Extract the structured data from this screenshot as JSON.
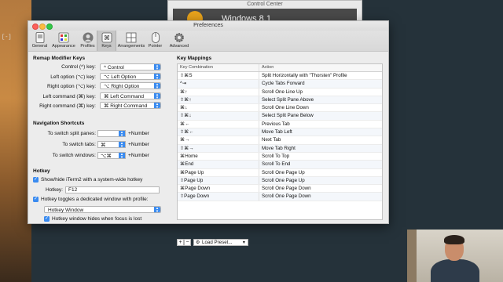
{
  "background": {
    "terminal_prompt": "[-]",
    "control_center": {
      "title": "Control Center",
      "item": "Windows 8.1"
    }
  },
  "window": {
    "title": "Preferences"
  },
  "toolbar": {
    "tabs": [
      {
        "label": "General",
        "icon": "general-icon"
      },
      {
        "label": "Appearance",
        "icon": "appearance-icon"
      },
      {
        "label": "Profiles",
        "icon": "profiles-icon"
      },
      {
        "label": "Keys",
        "icon": "keys-icon",
        "selected": true
      },
      {
        "label": "Arrangements",
        "icon": "arrangements-icon"
      },
      {
        "label": "Pointer",
        "icon": "pointer-icon"
      },
      {
        "label": "Advanced",
        "icon": "advanced-icon"
      }
    ]
  },
  "remap": {
    "title": "Remap Modifier Keys",
    "rows": [
      {
        "label": "Control (^) key:",
        "value": "^ Control"
      },
      {
        "label": "Left option (⌥) key:",
        "value": "⌥ Left Option"
      },
      {
        "label": "Right option (⌥) key:",
        "value": "⌥ Right Option"
      },
      {
        "label": "Left command (⌘) key:",
        "value": "⌘ Left Command"
      },
      {
        "label": "Right command (⌘) key:",
        "value": "⌘ Right Command"
      }
    ]
  },
  "navigation": {
    "title": "Navigation Shortcuts",
    "rows": [
      {
        "label": "To switch split panes:",
        "value": "",
        "suffix": "+Number"
      },
      {
        "label": "To switch tabs:",
        "value": "⌘",
        "suffix": "+Number"
      },
      {
        "label": "To switch windows:",
        "value": "⌥⌘",
        "suffix": "+Number"
      }
    ]
  },
  "hotkey": {
    "title": "Hotkey",
    "show_hide_label": "Show/hide iTerm2 with a system-wide hotkey",
    "hotkey_label": "Hotkey:",
    "hotkey_value": "F12",
    "toggles_label": "Hotkey toggles a dedicated window with profile:",
    "profile_value": "Hotkey Window",
    "hides_label": "Hotkey window hides when focus is lost"
  },
  "key_mappings": {
    "title": "Key Mappings",
    "col_combo": "Key Combination",
    "col_action": "Action",
    "rows": [
      {
        "combo": "⇧⌘S",
        "action": "Split Horizontally with \"Thorsten\" Profile"
      },
      {
        "combo": "^⇥",
        "action": "Cycle Tabs Forward"
      },
      {
        "combo": "⌘↑",
        "action": "Scroll One Line Up"
      },
      {
        "combo": "⇧⌘↑",
        "action": "Select Split Pane Above"
      },
      {
        "combo": "⌘↓",
        "action": "Scroll One Line Down"
      },
      {
        "combo": "⇧⌘↓",
        "action": "Select Split Pane Below"
      },
      {
        "combo": "⌘←",
        "action": "Previous Tab"
      },
      {
        "combo": "⇧⌘←",
        "action": "Move Tab Left"
      },
      {
        "combo": "⌘→",
        "action": "Next Tab"
      },
      {
        "combo": "⇧⌘→",
        "action": "Move Tab Right"
      },
      {
        "combo": "⌘Home",
        "action": "Scroll To Top"
      },
      {
        "combo": "⌘End",
        "action": "Scroll To End"
      },
      {
        "combo": "⌘Page Up",
        "action": "Scroll One Page Up"
      },
      {
        "combo": "⇧Page Up",
        "action": "Scroll One Page Up"
      },
      {
        "combo": "⌘Page Down",
        "action": "Scroll One Page Down"
      },
      {
        "combo": "⇧Page Down",
        "action": "Scroll One Page Down"
      }
    ],
    "add_label": "+",
    "remove_label": "−",
    "preset_label": "Load Preset..."
  }
}
